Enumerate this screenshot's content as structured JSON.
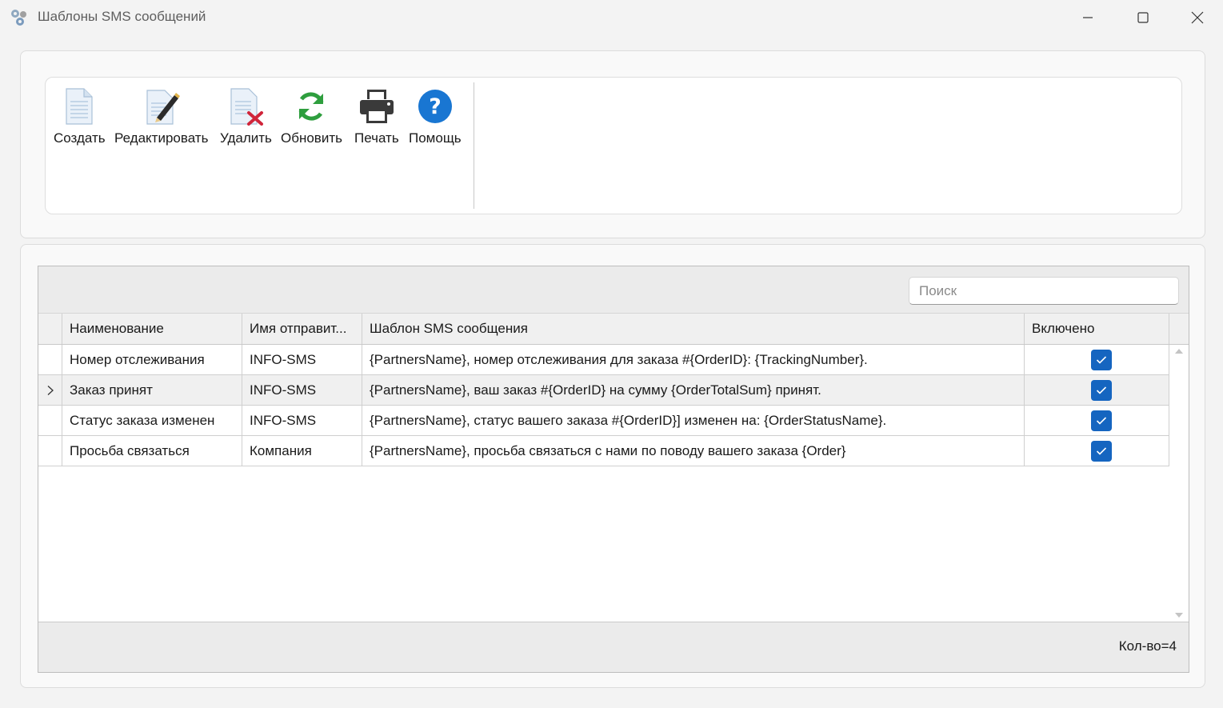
{
  "window": {
    "title": "Шаблоны SMS сообщений",
    "icon": "gear-app-icon"
  },
  "toolbar": {
    "buttons": [
      {
        "label": "Создать",
        "icon": "new-document-icon"
      },
      {
        "label": "Редактировать",
        "icon": "edit-document-icon"
      },
      {
        "label": "Удалить",
        "icon": "delete-document-icon"
      },
      {
        "label": "Обновить",
        "icon": "refresh-icon"
      },
      {
        "label": "Печать",
        "icon": "printer-icon"
      },
      {
        "label": "Помощь",
        "icon": "help-icon"
      }
    ]
  },
  "grid": {
    "search_placeholder": "Поиск",
    "columns": [
      "Наименование",
      "Имя отправит...",
      "Шаблон SMS сообщения",
      "Включено"
    ],
    "rows": [
      {
        "name": "Номер отслеживания",
        "sender": "INFO-SMS",
        "template": "{PartnersName}, номер отслеживания для заказа #{OrderID}: {TrackingNumber}.",
        "enabled": true,
        "selected": false
      },
      {
        "name": "Заказ принят",
        "sender": "INFO-SMS",
        "template": "{PartnersName}, ваш заказ #{OrderID} на сумму {OrderTotalSum} принят.",
        "enabled": true,
        "selected": true
      },
      {
        "name": "Статус заказа изменен",
        "sender": "INFO-SMS",
        "template": "{PartnersName}, статус вашего заказа #{OrderID}] изменен на: {OrderStatusName}.",
        "enabled": true,
        "selected": false
      },
      {
        "name": "Просьба связаться",
        "sender": "Компания",
        "template": "{PartnersName}, просьба связаться с нами по поводу вашего заказа {Order}",
        "enabled": true,
        "selected": false
      }
    ],
    "count_label": "Кол-во=4"
  },
  "colors": {
    "accent": "#1565c0",
    "refresh": "#2e9e3e",
    "delete": "#d0253a",
    "help": "#1976d2"
  }
}
